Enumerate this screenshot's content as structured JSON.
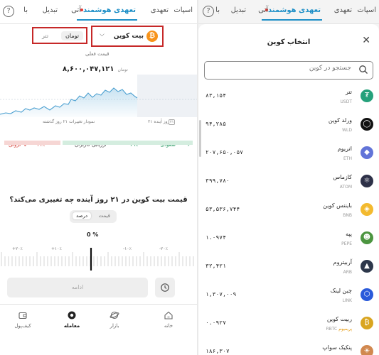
{
  "left": {
    "tabs": [
      {
        "label": "اسپات",
        "active": false
      },
      {
        "label": "تعهدی",
        "active": false
      },
      {
        "label": "تعهدی هوشمند",
        "active": true
      },
      {
        "label": "آتی",
        "active": false
      },
      {
        "label": "تبدیل",
        "active": false
      },
      {
        "label": "با",
        "active": false
      }
    ],
    "coin_name": "بیت کوین",
    "coin_symbol_letter": "₿",
    "currency_options": [
      "تومان",
      "تتر"
    ],
    "current_price_label": "قیمت فعلی",
    "current_price_value": "۸,۶۰۰,۰۴۷,۱۲۱",
    "current_price_unit": "تومان",
    "chart_caption_left": "نمودار تغییرات ۲۱ روز گذشته",
    "chart_caption_right": "۲۱ روز آینده",
    "chart_caption_icon": "۲۱",
    "sentiment_up_label": "صعودی",
    "sentiment_up_pct": "۶۹٪",
    "sentiment_down_label": "نزولی",
    "sentiment_down_pct": "۳۱٪",
    "sentiment_middle": "ارزیابی کاربران",
    "sentiment_up_fraction": 0.69,
    "question": "قیمت بیت کوین در ۲۱ روز آینده چه تغییری می‌کند؟",
    "seg_options": [
      "درصد",
      "قیمت"
    ],
    "seg_active": "درصد",
    "current_percent": "%",
    "current_percent_value": "0",
    "ruler_labels": [
      "+۲۰٪",
      "+۱۰٪",
      "-۱۰٪",
      "-۲۰٪"
    ],
    "continue_label": "ادامه",
    "nav": [
      {
        "label": "خانه",
        "icon": "home-icon"
      },
      {
        "label": "بازار",
        "icon": "market-icon"
      },
      {
        "label": "معامله",
        "icon": "trade-icon",
        "active": true
      },
      {
        "label": "کیف‌پول",
        "icon": "wallet-icon"
      }
    ]
  },
  "right": {
    "tabs": [
      {
        "label": "اسپات",
        "active": false
      },
      {
        "label": "تعهدی",
        "active": false
      },
      {
        "label": "تعهدی هوشمند",
        "active": true
      },
      {
        "label": "آتی",
        "active": false
      },
      {
        "label": "تبدیل",
        "active": false
      },
      {
        "label": "با",
        "active": false
      }
    ],
    "sheet_title": "انتخاب کوین",
    "search_placeholder": "جستجو در کوین",
    "coins": [
      {
        "name": "تتر",
        "symbol": "USDT",
        "value": "۸۳,۱۵۴",
        "color": "#26a17b",
        "icon": "tether-icon",
        "glyph": "₮"
      },
      {
        "name": "ورلد کوین",
        "symbol": "WLD",
        "value": "۹۴,۲۸۵",
        "color": "#111111",
        "icon": "worldcoin-icon",
        "glyph": "◯"
      },
      {
        "name": "اتریوم",
        "symbol": "ETH",
        "value": "۲۰۷,۶۵۰,۰۵۷",
        "color": "#6274d8",
        "icon": "ethereum-icon",
        "glyph": "◆"
      },
      {
        "name": "کازماس",
        "symbol": "ATOM",
        "value": "۳۹۹,۷۸۰",
        "color": "#2e3148",
        "icon": "cosmos-icon",
        "glyph": "⚛"
      },
      {
        "name": "بایننس کوین",
        "symbol": "BNB",
        "value": "۵۳,۵۳۶,۷۴۴",
        "color": "#f3ba2f",
        "icon": "bnb-icon",
        "glyph": "◈"
      },
      {
        "name": "پپه",
        "symbol": "PEPE",
        "value": "۱.۰۹۷۴",
        "color": "#4c9540",
        "icon": "pepe-icon",
        "glyph": "☻"
      },
      {
        "name": "آربیتروم",
        "symbol": "ARB",
        "value": "۳۲,۴۲۱",
        "color": "#2d374b",
        "icon": "arbitrum-icon",
        "glyph": "▲"
      },
      {
        "name": "چین لینک",
        "symbol": "LINK",
        "value": "۱,۳۰۷,۰۰۹",
        "color": "#2a5ada",
        "icon": "chainlink-icon",
        "glyph": "⬡"
      },
      {
        "name": "ربیت کوین",
        "symbol": "RBTC",
        "badge": "پریمیوم",
        "value": "۰.۰۹۲۷",
        "color": "#d9a520",
        "icon": "rbitcoin-icon",
        "glyph": "₿"
      },
      {
        "name": "پنکیک سواپ",
        "symbol": "CAKE",
        "value": "۱۸۶,۳۰۷",
        "color": "#d1884f",
        "icon": "pancakeswap-icon",
        "glyph": "☀"
      }
    ]
  }
}
